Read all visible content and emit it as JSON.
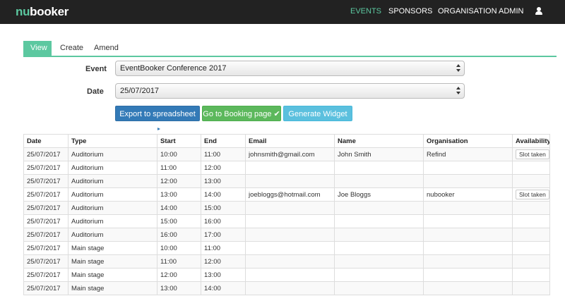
{
  "brand": {
    "part1": "nu",
    "part2": "booker"
  },
  "nav": [
    {
      "label": "EVENTS",
      "active": true
    },
    {
      "label": "SPONSORS"
    },
    {
      "label": "ORGANISATION"
    },
    {
      "label": "ADMIN"
    }
  ],
  "tabs": [
    {
      "label": "View",
      "active": true
    },
    {
      "label": "Create"
    },
    {
      "label": "Amend"
    }
  ],
  "form": {
    "event_label": "Event",
    "event_value": "EventBooker Conference 2017",
    "date_label": "Date",
    "date_value": "25/07/2017"
  },
  "buttons": {
    "export": "Export to spreadsheet",
    "booking": "Go to Booking page",
    "widget": "Generate Widget"
  },
  "table": {
    "headers": [
      "Date",
      "Type",
      "Start",
      "End",
      "Email",
      "Name",
      "Organisation",
      "Availability"
    ],
    "rows": [
      [
        "25/07/2017",
        "Auditorium",
        "10:00",
        "11:00",
        "johnsmith@gmail.com",
        "John Smith",
        "Refind",
        "Slot taken"
      ],
      [
        "25/07/2017",
        "Auditorium",
        "11:00",
        "12:00",
        "",
        "",
        "",
        ""
      ],
      [
        "25/07/2017",
        "Auditorium",
        "12:00",
        "13:00",
        "",
        "",
        "",
        ""
      ],
      [
        "25/07/2017",
        "Auditorium",
        "13:00",
        "14:00",
        "joebloggs@hotmail.com",
        "Joe Bloggs",
        "nubooker",
        "Slot taken"
      ],
      [
        "25/07/2017",
        "Auditorium",
        "14:00",
        "15:00",
        "",
        "",
        "",
        ""
      ],
      [
        "25/07/2017",
        "Auditorium",
        "15:00",
        "16:00",
        "",
        "",
        "",
        ""
      ],
      [
        "25/07/2017",
        "Auditorium",
        "16:00",
        "17:00",
        "",
        "",
        "",
        ""
      ],
      [
        "25/07/2017",
        "Main stage",
        "10:00",
        "11:00",
        "",
        "",
        "",
        ""
      ],
      [
        "25/07/2017",
        "Main stage",
        "11:00",
        "12:00",
        "",
        "",
        "",
        ""
      ],
      [
        "25/07/2017",
        "Main stage",
        "12:00",
        "13:00",
        "",
        "",
        "",
        ""
      ],
      [
        "25/07/2017",
        "Main stage",
        "13:00",
        "14:00",
        "",
        "",
        "",
        ""
      ]
    ]
  },
  "colors": {
    "accent": "#5cc8a0",
    "navbar": "#222222"
  }
}
